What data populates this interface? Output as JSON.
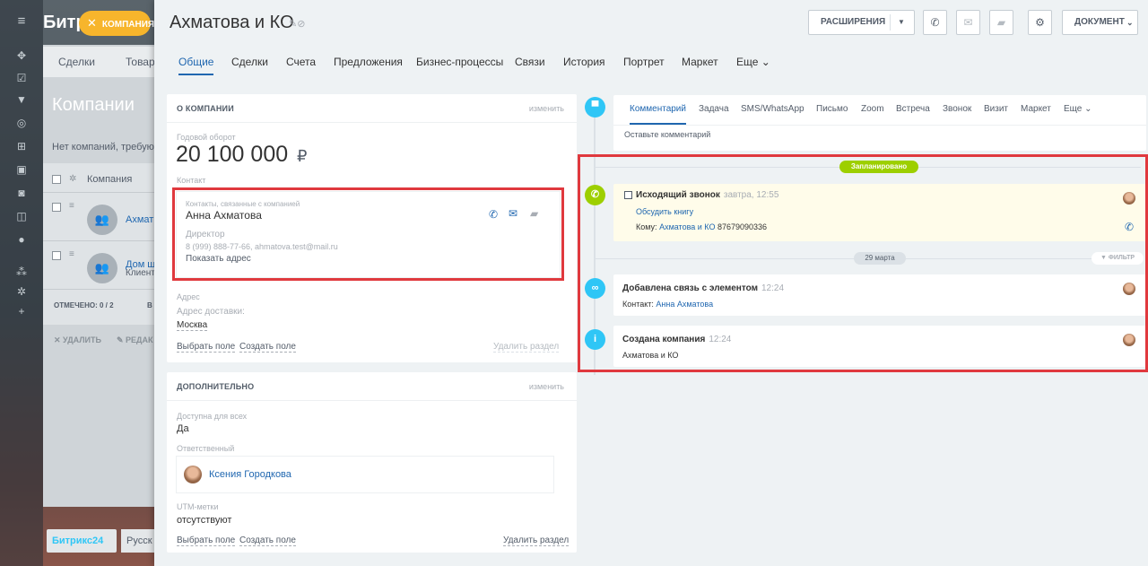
{
  "background": {
    "logo": "Битр",
    "company_chip": "КОМПАНИЯ",
    "nav": [
      "Сделки",
      "Товар"
    ],
    "page_title": "Компании",
    "hint": "Нет компаний, требую",
    "table_header": "Компания",
    "rows": [
      {
        "avatar": "👥",
        "link": "Ахмат"
      },
      {
        "avatar": "👥",
        "link": "Дом ш",
        "sub": "Клиент"
      }
    ],
    "selected": "ОТМЕЧЕНО: 0 / 2",
    "selected_extra": "В",
    "delete": "УДАЛИТЬ",
    "edit": "РЕДАК",
    "footer_logo": "Битрикс24",
    "footer_lang": "Русск"
  },
  "header": {
    "title": "Ахматова и КО",
    "extensions_btn": "РАСШИРЕНИЯ",
    "document_btn": "ДОКУМЕНТ"
  },
  "tabs": [
    "Общие",
    "Сделки",
    "Счета",
    "Предложения",
    "Бизнес-процессы",
    "Связи",
    "История",
    "Портрет",
    "Маркет",
    "Еще"
  ],
  "about": {
    "title": "О КОМПАНИИ",
    "edit": "изменить",
    "revenue_label": "Годовой оборот",
    "revenue_value": "20 100 000",
    "currency": "₽",
    "contact_label": "Контакт",
    "contact_box_label": "Контакты, связанные с компанией",
    "contact_name": "Анна Ахматова",
    "contact_role": "Директор",
    "contact_details": "8 (999) 888-77-66, ahmatova.test@mail.ru",
    "show_address": "Показать адрес",
    "address_label": "Адрес",
    "delivery_label": "Адрес доставки:",
    "delivery_value": "Москва",
    "select_field": "Выбрать поле",
    "create_field": "Создать поле",
    "delete_section": "Удалить раздел"
  },
  "additional": {
    "title": "ДОПОЛНИТЕЛЬНО",
    "edit": "изменить",
    "available_label": "Доступна для всех",
    "available_value": "Да",
    "responsible_label": "Ответственный",
    "responsible_name": "Ксения Городкова",
    "utm_label": "UTM-метки",
    "utm_value": "отсутствуют",
    "select_field": "Выбрать поле",
    "create_field": "Создать поле",
    "delete_section": "Удалить раздел"
  },
  "editor": {
    "tabs": [
      "Комментарий",
      "Задача",
      "SMS/WhatsApp",
      "Письмо",
      "Zoom",
      "Встреча",
      "Звонок",
      "Визит",
      "Маркет",
      "Еще"
    ],
    "placeholder": "Оставьте комментарий"
  },
  "timeline": {
    "planned_badge": "Запланировано",
    "call": {
      "title": "Исходящий звонок",
      "time": "завтра, 12:55",
      "subject": "Обсудить книгу",
      "to_label": "Кому:",
      "to_name": "Ахматова и КО",
      "to_phone": "87679090336"
    },
    "date_badge": "29 марта",
    "filter": "ФИЛЬТР",
    "link_item": {
      "title": "Добавлена связь с элементом",
      "time": "12:24",
      "text_label": "Контакт:",
      "text_link": "Анна Ахматова"
    },
    "created_item": {
      "title": "Создана компания",
      "time": "12:24",
      "text": "Ахматова и КО"
    }
  },
  "colors": {
    "accent": "#2067b0",
    "highlight": "#e0393e",
    "planned": "#9dcf00",
    "chip": "#f7b52c",
    "call_bg": "#fffcea"
  }
}
